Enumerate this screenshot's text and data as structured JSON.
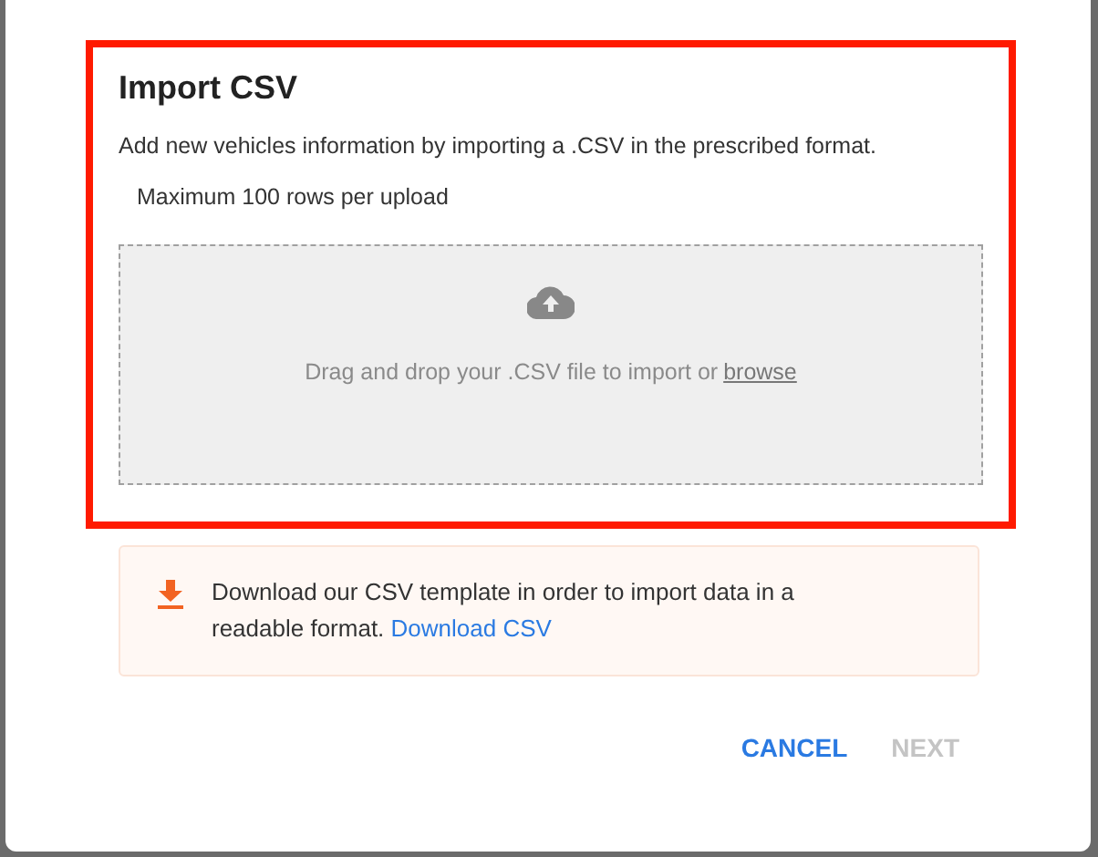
{
  "dialog": {
    "title": "Import CSV",
    "highlighted": true,
    "description": "Add new vehicles information by importing a .CSV in the prescribed format.",
    "limit_note": "Maximum 100 rows per upload",
    "dropzone": {
      "text": "Drag and drop your .CSV file to import or",
      "link": "browse"
    },
    "template_notice": {
      "text": "Download our CSV template in order to import data in a readable format.",
      "link": "Download CSV"
    },
    "buttons": [
      {
        "label": "CANCEL",
        "disabled": false
      },
      {
        "label": "NEXT",
        "disabled": true
      }
    ]
  }
}
